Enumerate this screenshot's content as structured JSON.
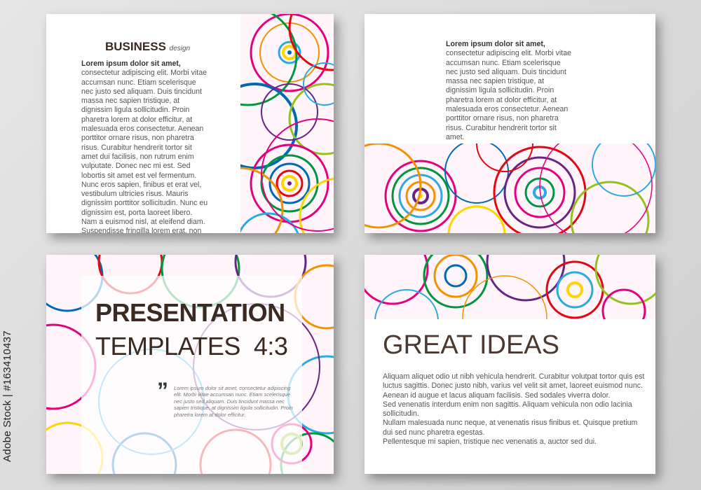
{
  "watermark": "Adobe Stock | #163410437",
  "slide1": {
    "title": "BUSINESS",
    "title_suffix": "design",
    "lead": "Lorem ipsum dolor sit amet,",
    "body": " consectetur adipiscing elit. Morbi vitae accumsan nunc. Etiam scelerisque nec justo sed aliquam. Duis tincidunt massa nec sapien tristique, at dignissim ligula sollicitudin. Proin pharetra lorem at dolor efficitur, at malesuada eros consectetur. Aenean porttitor ornare risus, non pharetra risus. Curabitur hendrerit tortor sit amet dui facilisis, non rutrum enim vulputate. Donec nec mi est. Sed lobortis sit amet est vel fermentum. Nunc eros sapien, finibus et erat vel, vestibulum ultricies risus. Mauris dignissim porttitor sollicitudin. Nunc eu dignissim est, porta laoreet libero. Nam a euismod nisl, at eleifend diam. Suspendisse fringilla lorem erat, non fringilla nibh feugiat eget."
  },
  "slide2": {
    "lead": "Lorem ipsum dolor sit amet,",
    "body": " consectetur adipiscing elit. Morbi vitae accumsan nunc. Etiam scelerisque nec justo sed aliquam. Duis tincidunt massa nec sapien tristique, at dignissim ligula sollicitudin. Proin pharetra lorem at dolor efficitur, at malesuada eros consectetur. Aenean porttitor ornare risus, non pharetra risus. Curabitur hendrerit tortor sit amet."
  },
  "slide3": {
    "title_line1": "PRESENTATION",
    "title_line2": "TEMPLATES  4:3",
    "quote_mark": "”",
    "quote_text": "Lorem ipsum dolor sit amet, consectetur adipiscing elit. Morbi vitae accumsan nunc. Etiam scelerisque nec justo sed aliquam. Duis tincidunt massa nec sapien tristique, at dignissim ligula sollicitudin. Proin pharetra lorem at dolor efficitur."
  },
  "slide4": {
    "title": "GREAT IDEAS",
    "p1": "Aliquam aliquet odio ut nibh vehicula hendrerit. Curabitur volutpat tortor quis est luctus sagittis. Donec justo nibh, varius vel velit sit amet, laoreet euismod nunc. Aenean id augue et lacus aliquam facilisis. Sed sodales viverra dolor.",
    "p2": "Sed venenatis interdum enim non sagittis. Aliquam vehicula non odio lacinia sollicitudin.",
    "p3": "Nullam malesuada nunc neque, at venenatis risus finibus et. Quisque pretium dui sed nunc pharetra egestas.",
    "p4": "Pellentesque mi sapien, tristique nec venenatis a, auctor sed dui."
  },
  "colors": {
    "background": "#d9d9d9",
    "circle_palette": [
      "#e5007e",
      "#f39200",
      "#ffd400",
      "#009640",
      "#0069b4",
      "#29abe2",
      "#662483",
      "#e30613",
      "#95c11f"
    ]
  }
}
